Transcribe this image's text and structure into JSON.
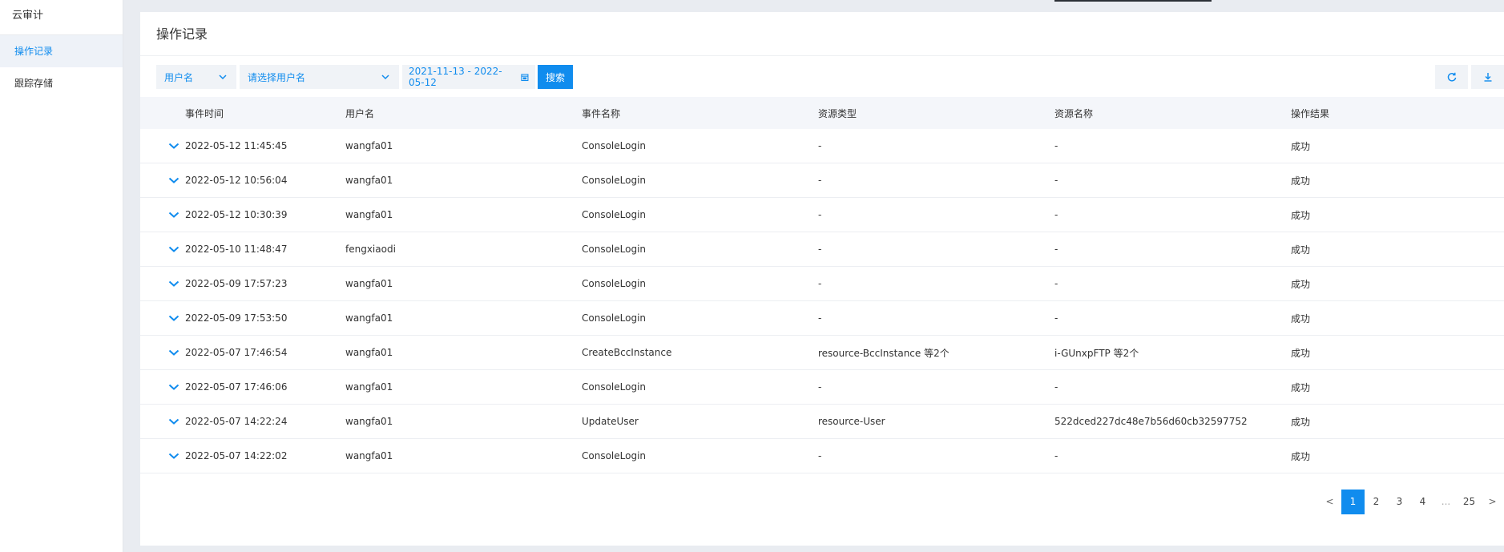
{
  "sidebar": {
    "title": "云审计",
    "items": [
      {
        "label": "操作记录",
        "active": true
      },
      {
        "label": "跟踪存储",
        "active": false
      }
    ]
  },
  "page": {
    "title": "操作记录"
  },
  "toolbar": {
    "filter_type": "用户名",
    "user_placeholder": "请选择用户名",
    "date_range": "2021-11-13 - 2022-05-12",
    "search_label": "搜索"
  },
  "table": {
    "headers": [
      "事件时间",
      "用户名",
      "事件名称",
      "资源类型",
      "资源名称",
      "操作结果"
    ],
    "rows": [
      [
        "2022-05-12 11:45:45",
        "wangfa01",
        "ConsoleLogin",
        "-",
        "-",
        "成功"
      ],
      [
        "2022-05-12 10:56:04",
        "wangfa01",
        "ConsoleLogin",
        "-",
        "-",
        "成功"
      ],
      [
        "2022-05-12 10:30:39",
        "wangfa01",
        "ConsoleLogin",
        "-",
        "-",
        "成功"
      ],
      [
        "2022-05-10 11:48:47",
        "fengxiaodi",
        "ConsoleLogin",
        "-",
        "-",
        "成功"
      ],
      [
        "2022-05-09 17:57:23",
        "wangfa01",
        "ConsoleLogin",
        "-",
        "-",
        "成功"
      ],
      [
        "2022-05-09 17:53:50",
        "wangfa01",
        "ConsoleLogin",
        "-",
        "-",
        "成功"
      ],
      [
        "2022-05-07 17:46:54",
        "wangfa01",
        "CreateBccInstance",
        "resource-BccInstance 等2个",
        "i-GUnxpFTP 等2个",
        "成功"
      ],
      [
        "2022-05-07 17:46:06",
        "wangfa01",
        "ConsoleLogin",
        "-",
        "-",
        "成功"
      ],
      [
        "2022-05-07 14:22:24",
        "wangfa01",
        "UpdateUser",
        "resource-User",
        "522dced227dc48e7b56d60cb32597752",
        "成功"
      ],
      [
        "2022-05-07 14:22:02",
        "wangfa01",
        "ConsoleLogin",
        "-",
        "-",
        "成功"
      ]
    ]
  },
  "pagination": {
    "prev": "<",
    "pages": [
      "1",
      "2",
      "3",
      "4"
    ],
    "ellipsis": "...",
    "last": "25",
    "next": ">",
    "current": "1"
  },
  "colors": {
    "accent": "#108cee",
    "page_bg": "#e9ecf1",
    "header_bg": "#f4f6fa"
  },
  "icons": [
    "chevron-down-icon",
    "calendar-icon",
    "refresh-icon",
    "download-icon",
    "expand-row-icon"
  ]
}
